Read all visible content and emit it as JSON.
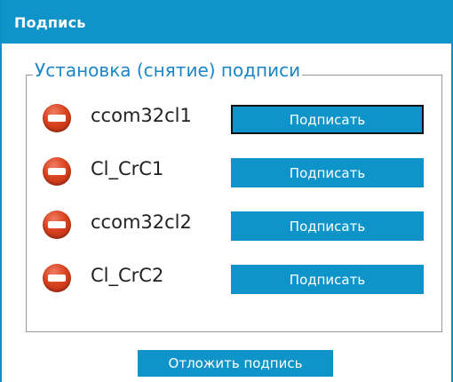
{
  "header": {
    "title": "Подпись"
  },
  "signature_group": {
    "legend": "Установка (снятие) подписи",
    "rows": [
      {
        "name": "ccom32cl1",
        "status_icon": "no-entry-icon",
        "button_label": "Подписать"
      },
      {
        "name": "Cl_CrC1",
        "status_icon": "no-entry-icon",
        "button_label": "Подписать"
      },
      {
        "name": "ccom32cl2",
        "status_icon": "no-entry-icon",
        "button_label": "Подписать"
      },
      {
        "name": "Cl_CrC2",
        "status_icon": "no-entry-icon",
        "button_label": "Подписать"
      }
    ]
  },
  "actions": {
    "defer_label": "Отложить подпись"
  },
  "colors": {
    "accent": "#0f94c9",
    "legend_text": "#1b86c5",
    "status_icon": "#d8431f"
  }
}
